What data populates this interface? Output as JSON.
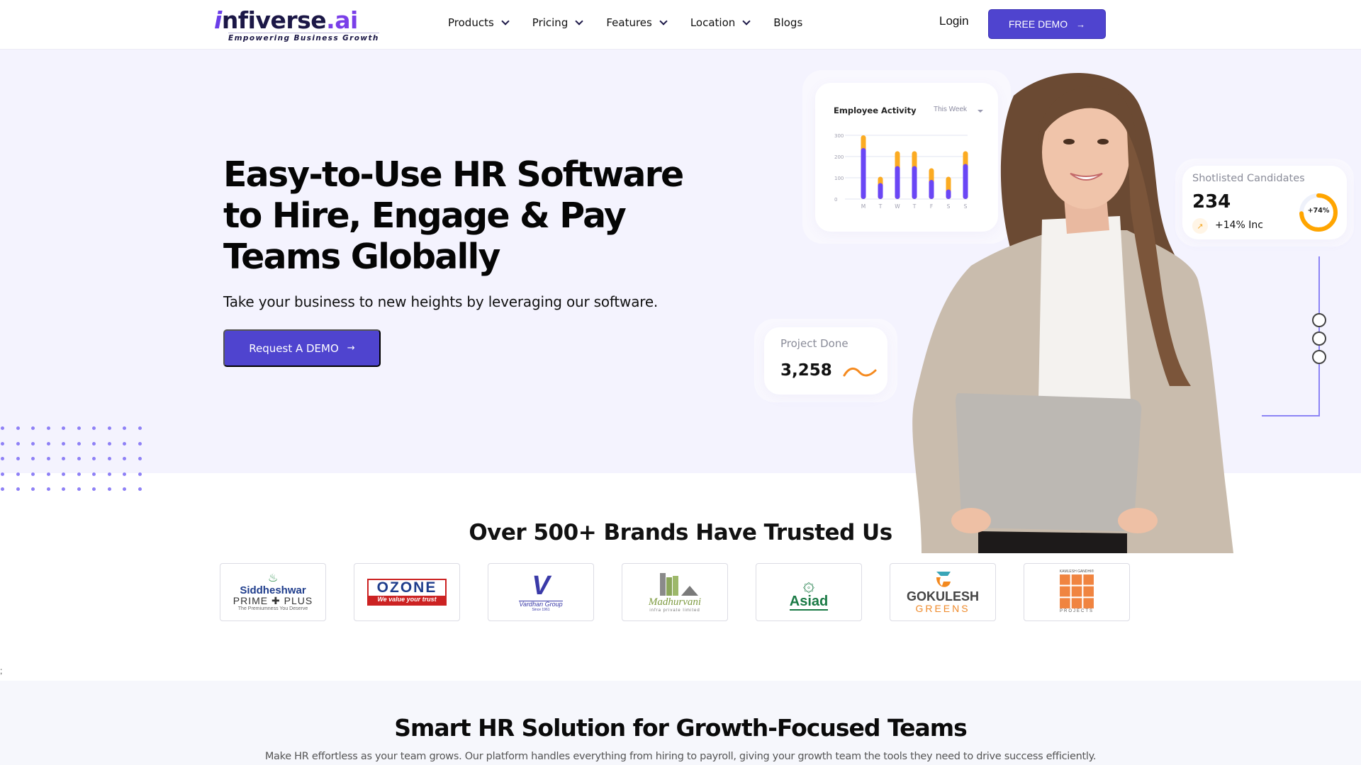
{
  "header": {
    "logo": {
      "prefix": "i",
      "name": "nfiverse",
      "suffix": ".ai",
      "tagline": "Empowering Business Growth"
    },
    "nav": [
      {
        "label": "Products",
        "has_dropdown": true
      },
      {
        "label": "Pricing",
        "has_dropdown": true
      },
      {
        "label": "Features",
        "has_dropdown": true
      },
      {
        "label": "Location",
        "has_dropdown": true
      },
      {
        "label": "Blogs",
        "has_dropdown": false
      }
    ],
    "login_label": "Login",
    "free_demo_label": "FREE DEMO",
    "arrow_glyph": "→"
  },
  "hero": {
    "title": "Easy-to-Use HR Software to Hire, Engage & Pay Teams Globally",
    "subtitle": "Take your business to new heights by leveraging our software.",
    "cta_label": "Request A DEMO"
  },
  "cards": {
    "employee_activity": {
      "title": "Employee Activity",
      "range": "This Week"
    },
    "shortlisted": {
      "label": "Shotlisted Candidates",
      "value": "234",
      "trend": "+14% Inc",
      "trend_icon": "↗",
      "donut_label": "+74%",
      "donut_percent": 74
    },
    "project_done": {
      "label": "Project Done",
      "value": "3,258"
    }
  },
  "chart_data": {
    "type": "bar",
    "title": "Employee Activity",
    "subtitle": "This Week",
    "categories": [
      "M",
      "T",
      "W",
      "T",
      "F",
      "S",
      "S"
    ],
    "series": [
      {
        "name": "primary",
        "color": "#6a46f5",
        "values": [
          240,
          75,
          155,
          155,
          90,
          45,
          165
        ]
      },
      {
        "name": "secondary",
        "color": "#fbab22",
        "values": [
          60,
          30,
          70,
          70,
          55,
          60,
          60
        ]
      }
    ],
    "stacked": true,
    "yticks": [
      "0",
      "100",
      "200",
      "300"
    ],
    "ylim": [
      0,
      300
    ],
    "xlabel": "",
    "ylabel": "",
    "grid": true
  },
  "steps": {
    "count": 3
  },
  "brands": {
    "title": "Over 500+ Brands Have Trusted Us",
    "items": [
      {
        "name": "Siddheshwar Prime Plus",
        "lines": [
          "Siddheshwar",
          "PRIME ✚ PLUS",
          "The Premiumness You Deserve"
        ]
      },
      {
        "name": "Ozone",
        "lines": [
          "OZONE",
          "We value your trust"
        ]
      },
      {
        "name": "Vardhan Group",
        "lines": [
          "V",
          "Vardhan Group",
          "Since 1961"
        ]
      },
      {
        "name": "Madhurvani",
        "lines": [
          "Madhurvani",
          "infra private limited"
        ]
      },
      {
        "name": "Asiad",
        "lines": [
          "Asiad"
        ]
      },
      {
        "name": "Gokulesh Greens",
        "lines": [
          "GOKULESH",
          "GREENS"
        ]
      },
      {
        "name": "Kamlesh Gandhi Projects",
        "lines": [
          "KAMLESH GANDHI®",
          "PROJECTS"
        ]
      }
    ]
  },
  "stray_text": ";",
  "smart": {
    "title": "Smart HR Solution for Growth-Focused Teams",
    "subtitle": "Make HR effortless as your team grows. Our platform handles everything from hiring to payroll, giving your growth team the tools they need to drive success efficiently."
  },
  "colors": {
    "accent": "#4f44cf",
    "hero_bg": "#f4f3fe",
    "bar_primary": "#6a46f5",
    "bar_secondary": "#fbab22",
    "donut": "#ffa500",
    "connector": "#8b83f5"
  }
}
